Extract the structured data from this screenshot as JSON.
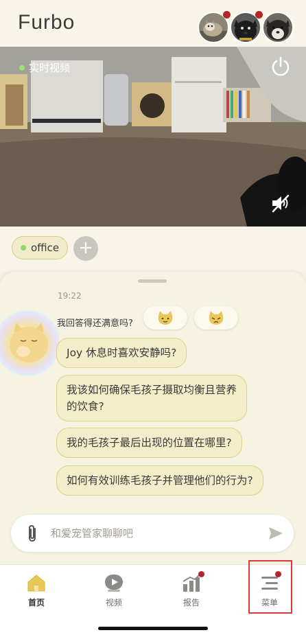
{
  "header": {
    "logo": "Furbo",
    "pets": [
      {
        "name": "pet-avatar-cat",
        "has_notification": true
      },
      {
        "name": "pet-avatar-black-dog",
        "has_notification": true
      },
      {
        "name": "pet-avatar-shiba",
        "has_notification": false
      }
    ]
  },
  "video": {
    "live_label": "实时视频"
  },
  "devices": {
    "current": "office",
    "add_label": "+"
  },
  "chat": {
    "timestamp": "19:22",
    "satisfaction_prompt": "我回答得还满意吗?",
    "suggestions": [
      "Joy 休息时喜欢安静吗?",
      "我该如何确保毛孩子摄取均衡且营养的饮食?",
      "我的毛孩子最后出现的位置在哪里?",
      "如何有效训练毛孩子并管理他们的行为?"
    ],
    "suggestion_lines": [
      [
        "Joy 休息时喜欢安静吗?"
      ],
      [
        "我该如何确保毛孩子摄取均衡且营养",
        "的饮食?"
      ],
      [
        "我的毛孩子最后出现的位置在哪里?"
      ],
      [
        "如何有效训练毛孩子并管理他们的行为?"
      ]
    ]
  },
  "input": {
    "placeholder": "和爱宠管家聊聊吧"
  },
  "nav": {
    "items": [
      {
        "label": "首页",
        "icon": "home-icon",
        "active": true
      },
      {
        "label": "视频",
        "icon": "video-play-icon",
        "active": false
      },
      {
        "label": "报告",
        "icon": "report-chart-icon",
        "active": false,
        "has_notification": true
      },
      {
        "label": "菜单",
        "icon": "menu-icon",
        "active": false,
        "has_notification": true
      }
    ]
  },
  "colors": {
    "accent": "#f4edc9",
    "accent_border": "#ddd08a",
    "notification": "#b3262b",
    "live": "#9be36a"
  }
}
